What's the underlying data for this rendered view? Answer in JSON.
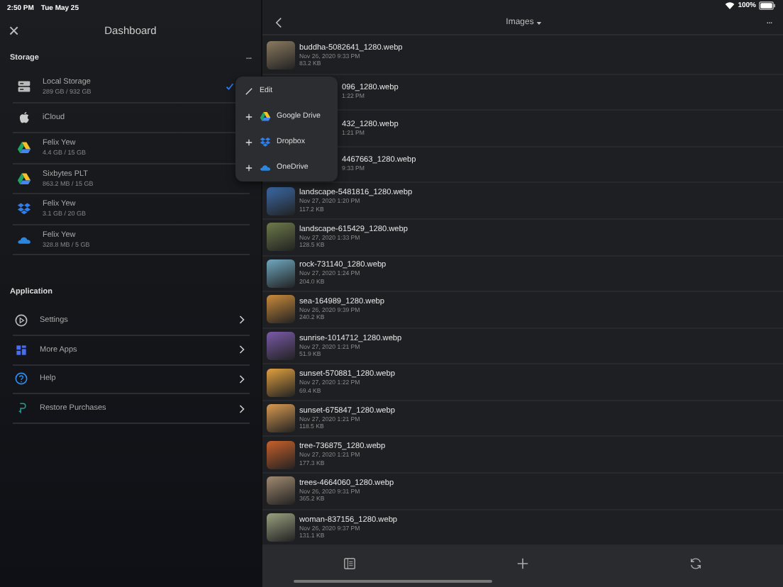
{
  "status_bar": {
    "time": "2:50 PM",
    "date": "Tue May 25",
    "battery": "100%"
  },
  "sidebar": {
    "close": "×",
    "title": "Dashboard",
    "storage": {
      "title": "Storage",
      "more": "···",
      "items": [
        {
          "kind": "disk",
          "name": "Local Storage",
          "usage": "289 GB / 932 GB",
          "selected": true
        },
        {
          "kind": "icloud",
          "name": "iCloud",
          "selected": false
        },
        {
          "kind": "gdrive",
          "name": "Felix Yew",
          "usage": "4.4 GB / 15 GB",
          "selected": false
        },
        {
          "kind": "gdrive",
          "name": "Sixbytes PLT",
          "usage": "863.2 MB / 15 GB",
          "selected": false
        },
        {
          "kind": "dropbox",
          "name": "Felix Yew",
          "usage": "3.1 GB / 20 GB",
          "selected": false
        },
        {
          "kind": "onedrive",
          "name": "Felix Yew",
          "usage": "328.8 MB / 5 GB",
          "selected": false
        }
      ]
    },
    "application": {
      "title": "Application",
      "items": [
        {
          "kind": "settings",
          "label": "Settings"
        },
        {
          "kind": "apps",
          "label": "More Apps"
        },
        {
          "kind": "help",
          "label": "Help"
        },
        {
          "kind": "restore",
          "label": "Restore Purchases"
        }
      ]
    }
  },
  "menu": {
    "items": [
      {
        "kind": "edit",
        "label": "Edit"
      },
      {
        "kind": "gdrive",
        "label": "Google Drive"
      },
      {
        "kind": "dropbox",
        "label": "Dropbox"
      },
      {
        "kind": "onedrive",
        "label": "OneDrive"
      }
    ]
  },
  "browser": {
    "title": "Images",
    "more": "···",
    "files": [
      {
        "name": "buddha-5082641_1280.webp",
        "date": "Nov 26, 2020 9:33 PM",
        "size": "83.2 KB",
        "covered": false
      },
      {
        "name": "096_1280.webp",
        "date": "1:22 PM",
        "covered": true
      },
      {
        "name": "432_1280.webp",
        "date": "1:21 PM",
        "covered": true
      },
      {
        "name": "4467663_1280.webp",
        "date": "9:33 PM",
        "covered": true
      },
      {
        "name": "landscape-5481816_1280.webp",
        "date": "Nov 27, 2020 1:20 PM",
        "size": "117.2 KB",
        "covered": false
      },
      {
        "name": "landscape-615429_1280.webp",
        "date": "Nov 27, 2020 1:33 PM",
        "size": "128.5 KB",
        "covered": false
      },
      {
        "name": "rock-731140_1280.webp",
        "date": "Nov 27, 2020 1:24 PM",
        "size": "204.0 KB",
        "covered": false
      },
      {
        "name": "sea-164989_1280.webp",
        "date": "Nov 26, 2020 9:39 PM",
        "size": "240.2 KB",
        "covered": false
      },
      {
        "name": "sunrise-1014712_1280.webp",
        "date": "Nov 27, 2020 1:21 PM",
        "size": "51.9 KB",
        "covered": false
      },
      {
        "name": "sunset-570881_1280.webp",
        "date": "Nov 27, 2020 1:22 PM",
        "size": "69.4 KB",
        "covered": false
      },
      {
        "name": "sunset-675847_1280.webp",
        "date": "Nov 27, 2020 1:21 PM",
        "size": "118.5 KB",
        "covered": false
      },
      {
        "name": "tree-736875_1280.webp",
        "date": "Nov 27, 2020 1:21 PM",
        "size": "177.3 KB",
        "covered": false
      },
      {
        "name": "trees-4664060_1280.webp",
        "date": "Nov 26, 2020 9:31 PM",
        "size": "365.2 KB",
        "covered": false
      },
      {
        "name": "woman-837156_1280.webp",
        "date": "Nov 26, 2020 9:37 PM",
        "size": "131.1 KB",
        "covered": false
      }
    ]
  }
}
